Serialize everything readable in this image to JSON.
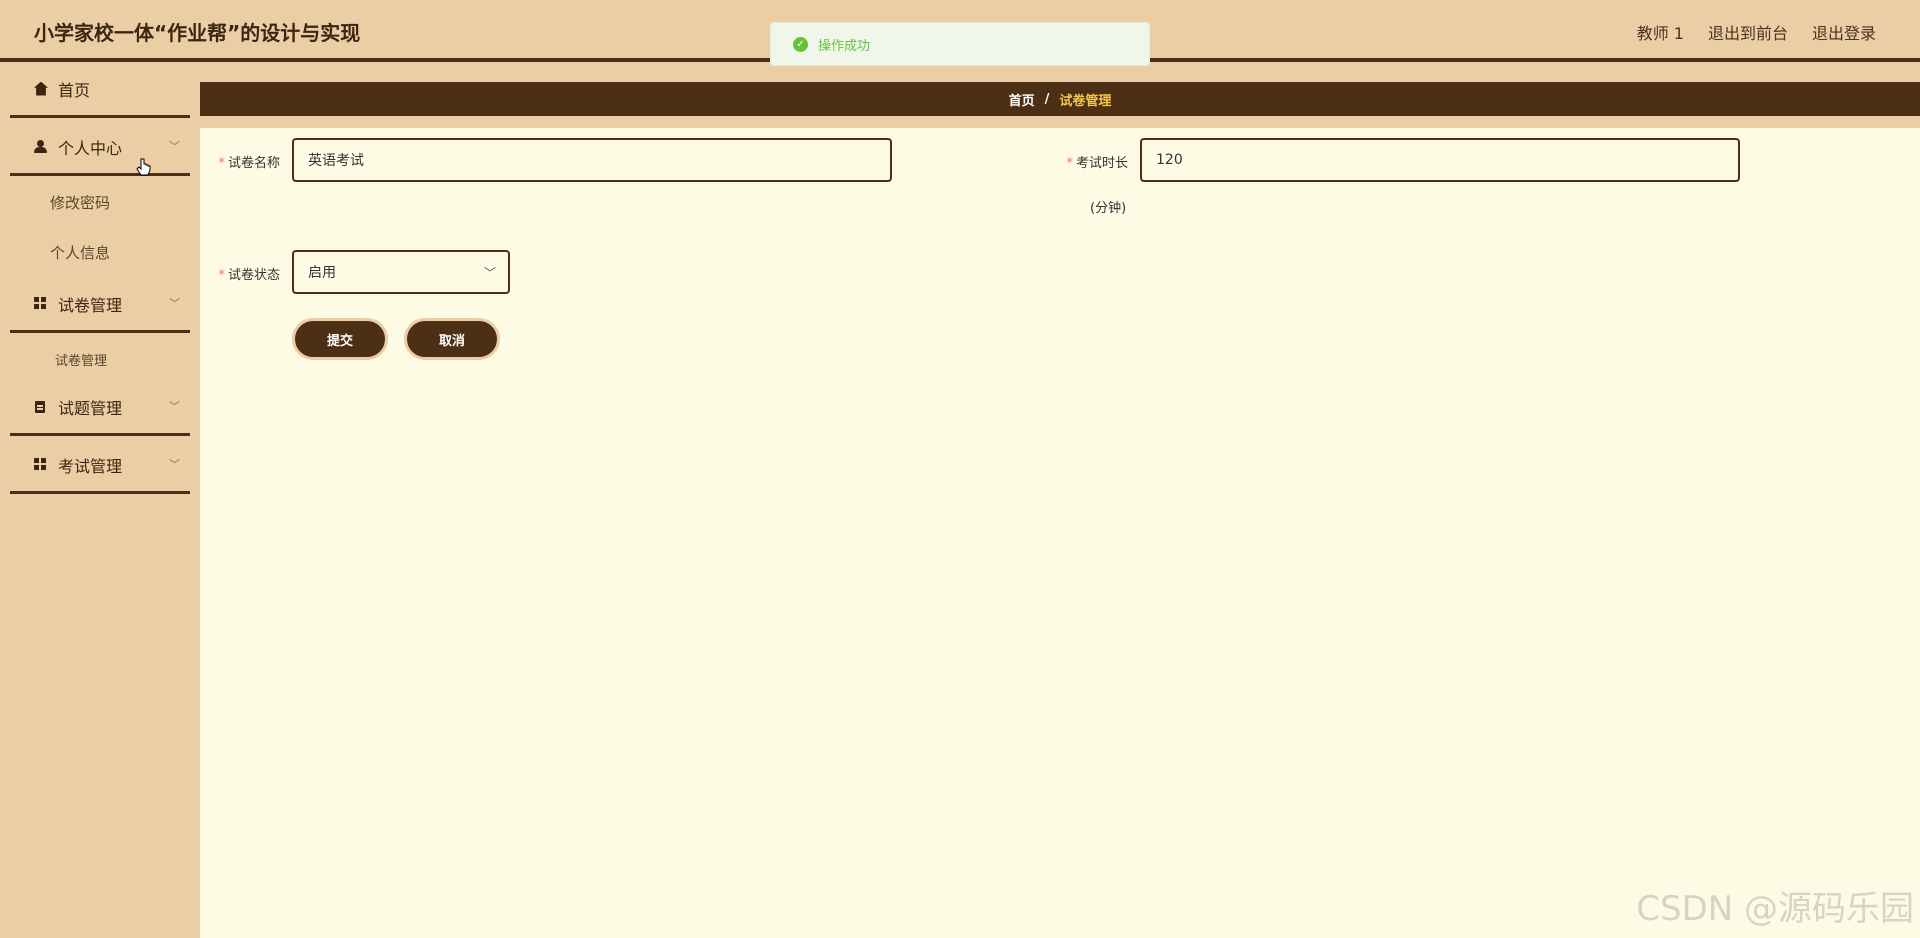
{
  "header": {
    "title": "小学家校一体“作业帮”的设计与实现",
    "links": [
      "教师 1",
      "退出到前台",
      "退出登录"
    ]
  },
  "toast": {
    "message": "操作成功",
    "icon": "check-circle-icon",
    "color": "#67c23a"
  },
  "sidebar": {
    "items": [
      {
        "label": "首页",
        "icon": "home-icon"
      },
      {
        "label": "个人中心",
        "icon": "user-icon",
        "sub": [
          "修改密码",
          "个人信息"
        ]
      },
      {
        "label": "试卷管理",
        "icon": "grid-icon",
        "sub": [
          "试卷管理"
        ]
      },
      {
        "label": "试题管理",
        "icon": "clipboard-icon"
      },
      {
        "label": "考试管理",
        "icon": "grid-icon"
      }
    ]
  },
  "breadcrumb": {
    "home": "首页",
    "separator": "/",
    "current": "试卷管理"
  },
  "form": {
    "name_label": "试卷名称",
    "name_value": "英语考试",
    "duration_label": "考试时长",
    "duration_unit": "(分钟)",
    "duration_value": "120",
    "status_label": "试卷状态",
    "status_value": "启用",
    "required_mark": "*"
  },
  "buttons": {
    "submit": "提交",
    "cancel": "取消"
  },
  "watermark": "CSDN @源码乐园",
  "colors": {
    "accent": "#4d2f16",
    "header_bg": "#ebcea5",
    "page_bg": "#fdfbe3",
    "breadcrumb_current": "#f4c64e"
  }
}
